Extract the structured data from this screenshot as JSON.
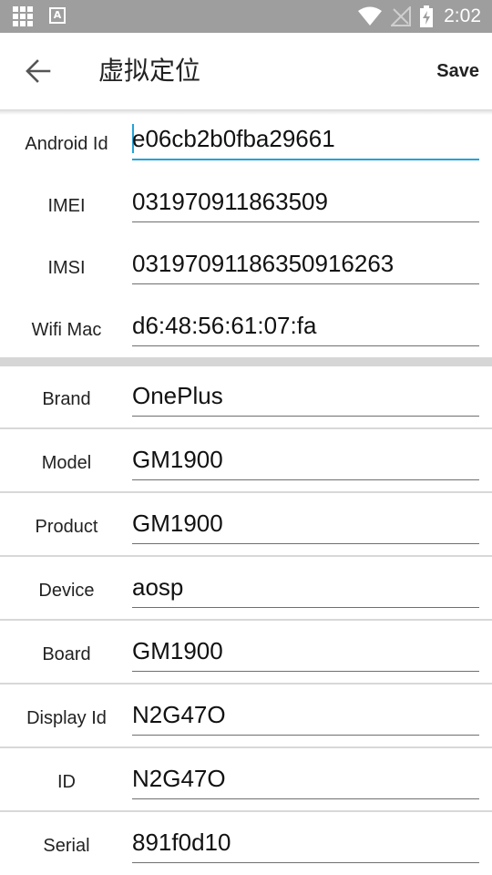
{
  "status_bar": {
    "time": "2:02",
    "notification_letter": "A",
    "icons": [
      "apps-grid-icon",
      "text-input-icon",
      "wifi-icon",
      "no-signal-icon",
      "battery-charging-icon"
    ]
  },
  "app_bar": {
    "title": "虚拟定位",
    "save_label": "Save",
    "back_icon": "arrow-left-icon"
  },
  "ids_section": [
    {
      "label": "Android Id",
      "value": "e06cb2b0fba29661",
      "focused": true
    },
    {
      "label": "IMEI",
      "value": "031970911863509"
    },
    {
      "label": "IMSI",
      "value": "03197091186350916263"
    },
    {
      "label": "Wifi Mac",
      "value": "d6:48:56:61:07:fa"
    }
  ],
  "build_section": [
    {
      "label": "Brand",
      "value": "OnePlus"
    },
    {
      "label": "Model",
      "value": "GM1900"
    },
    {
      "label": "Product",
      "value": "GM1900"
    },
    {
      "label": "Device",
      "value": "aosp"
    },
    {
      "label": "Board",
      "value": "GM1900"
    },
    {
      "label": "Display Id",
      "value": "N2G47O"
    },
    {
      "label": "ID",
      "value": "N2G47O"
    },
    {
      "label": "Serial",
      "value": "891f0d10"
    }
  ],
  "colors": {
    "status_bar": "#9e9e9e",
    "accent": "#22a3d9",
    "divider": "#d8d8d8"
  }
}
